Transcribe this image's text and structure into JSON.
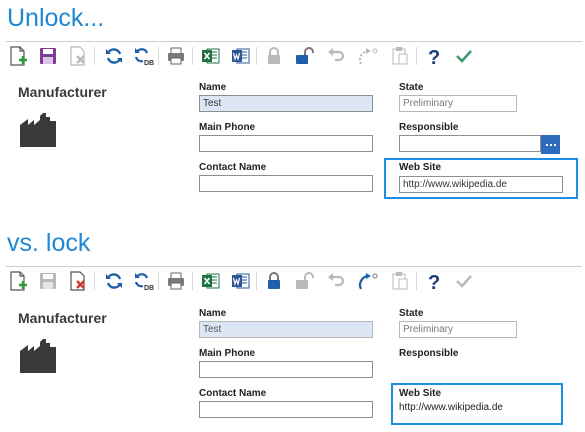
{
  "unlock_section": {
    "heading": "Unlock...",
    "toolbar": [
      {
        "name": "new-record-icon",
        "state": "enabled"
      },
      {
        "name": "save-icon",
        "state": "enabled"
      },
      {
        "name": "delete-icon",
        "state": "disabled"
      },
      {
        "name": "refresh-icon",
        "state": "enabled"
      },
      {
        "name": "refresh-db-icon",
        "state": "enabled"
      },
      {
        "name": "print-icon",
        "state": "enabled"
      },
      {
        "name": "excel-export-icon",
        "state": "enabled"
      },
      {
        "name": "word-export-icon",
        "state": "enabled"
      },
      {
        "name": "lock-icon",
        "state": "disabled"
      },
      {
        "name": "unlock-icon",
        "state": "enabled"
      },
      {
        "name": "undo-icon",
        "state": "disabled"
      },
      {
        "name": "redo-icon",
        "state": "disabled"
      },
      {
        "name": "paste-icon",
        "state": "disabled"
      },
      {
        "name": "help-icon",
        "state": "enabled"
      },
      {
        "name": "check-icon",
        "state": "enabled"
      }
    ],
    "entity_label": "Manufacturer",
    "name_label": "Name",
    "name_value": "Test",
    "state_label": "State",
    "state_value": "Preliminary",
    "main_phone_label": "Main Phone",
    "main_phone_value": "",
    "responsible_label": "Responsible",
    "responsible_value": "",
    "contact_name_label": "Contact Name",
    "contact_name_value": "",
    "website_label": "Web Site",
    "website_value": "http://www.wikipedia.de"
  },
  "lock_section": {
    "heading": "vs. lock",
    "toolbar": [
      {
        "name": "new-record-icon",
        "state": "enabled"
      },
      {
        "name": "save-icon",
        "state": "disabled"
      },
      {
        "name": "delete-icon",
        "state": "enabled"
      },
      {
        "name": "refresh-icon",
        "state": "enabled"
      },
      {
        "name": "refresh-db-icon",
        "state": "enabled"
      },
      {
        "name": "print-icon",
        "state": "enabled"
      },
      {
        "name": "excel-export-icon",
        "state": "enabled"
      },
      {
        "name": "word-export-icon",
        "state": "enabled"
      },
      {
        "name": "lock-icon",
        "state": "enabled"
      },
      {
        "name": "unlock-icon",
        "state": "disabled"
      },
      {
        "name": "undo-icon",
        "state": "disabled"
      },
      {
        "name": "redo-icon",
        "state": "enabled"
      },
      {
        "name": "paste-icon",
        "state": "disabled"
      },
      {
        "name": "help-icon",
        "state": "enabled"
      },
      {
        "name": "check-icon",
        "state": "disabled"
      }
    ],
    "entity_label": "Manufacturer",
    "name_label": "Name",
    "name_value": "Test",
    "state_label": "State",
    "state_value": "Preliminary",
    "main_phone_label": "Main Phone",
    "main_phone_value": "",
    "responsible_label": "Responsible",
    "contact_name_label": "Contact Name",
    "contact_name_value": "",
    "website_label": "Web Site",
    "website_value": "http://www.wikipedia.de"
  },
  "colors": {
    "heading": "#1e88d4",
    "highlight_border": "#1e8fe0",
    "name_field_bg": "#dde6f4",
    "lookup_button": "#2f6bbd"
  }
}
